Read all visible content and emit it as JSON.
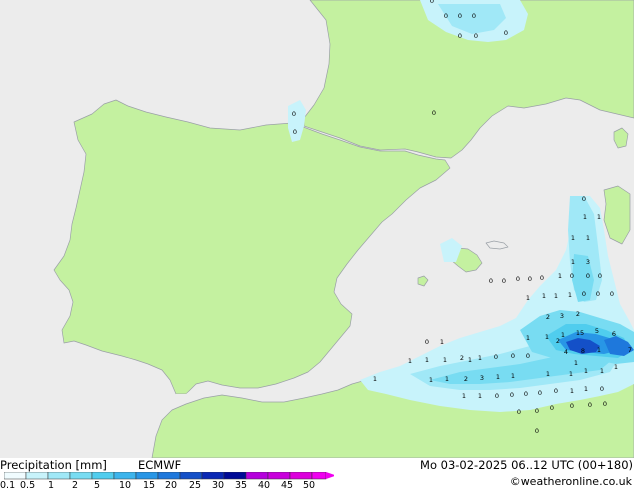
{
  "legend": {
    "title": "Precipitation [mm]",
    "model": "ECMWF",
    "datetime": "Mo 03-02-2025 06..12 UTC (00+180)",
    "credit": "©weatheronline.co.uk",
    "scale_labels": [
      "0.1",
      "0.5",
      "1",
      "2",
      "5",
      "10",
      "15",
      "20",
      "25",
      "30",
      "35",
      "40",
      "45",
      "50"
    ],
    "scale_colors": [
      "#f0fcff",
      "#c8f3fb",
      "#a0e8f7",
      "#78dcf2",
      "#50cdee",
      "#3cb4ec",
      "#2896e6",
      "#1e78dc",
      "#1450c8",
      "#0a28b4",
      "#000a96",
      "#b400dc",
      "#c800dc",
      "#dc00dc",
      "#f000f0"
    ]
  },
  "map": {
    "land_color": "#c4f1a0",
    "sea_color": "#ececec",
    "precip_values": [
      "0",
      "0",
      "0",
      "0",
      "0",
      "0",
      "0",
      "0",
      "0",
      "0",
      "0",
      "1",
      "1",
      "1",
      "1",
      "1",
      "2",
      "1",
      "15",
      "5",
      "6",
      "7",
      "4",
      "8",
      "1",
      "1",
      "2",
      "3",
      "2",
      "2",
      "3",
      "1",
      "1",
      "1",
      "1",
      "1",
      "1",
      "1",
      "1",
      "1",
      "1",
      "0",
      "0",
      "0",
      "0",
      "1",
      "1",
      "1",
      "1",
      "2",
      "3",
      "1",
      "1",
      "0",
      "0",
      "0",
      "1",
      "1",
      "1",
      "0",
      "0",
      "0",
      "1",
      "0",
      "0",
      "0",
      "0",
      "0",
      "1",
      "1",
      "1",
      "1",
      "1",
      "0",
      "0",
      "0",
      "0",
      "0",
      "1",
      "1",
      "0",
      "0",
      "0",
      "0",
      "0",
      "0",
      "0",
      "0"
    ]
  }
}
